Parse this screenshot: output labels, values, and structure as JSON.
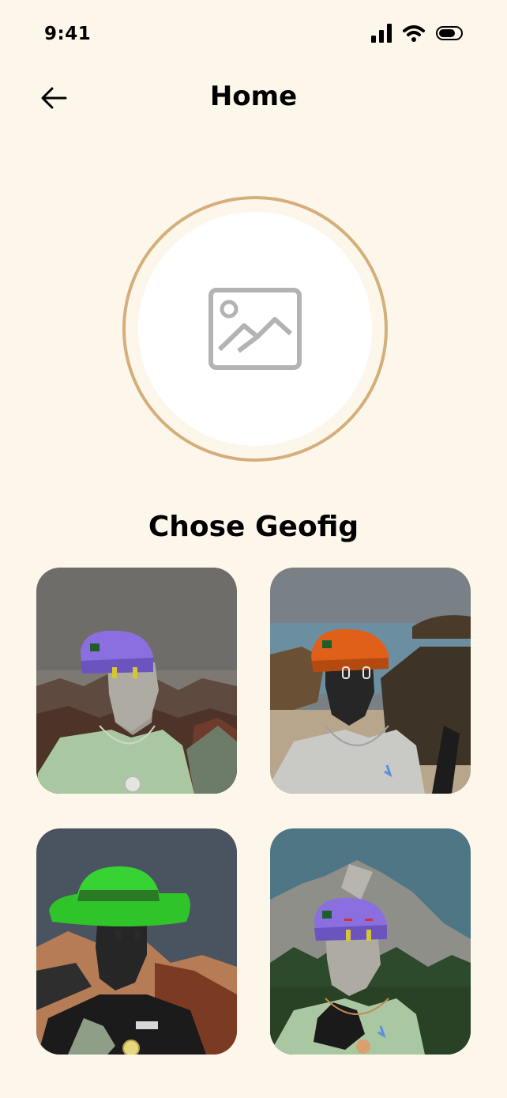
{
  "status_bar": {
    "time": "9:41"
  },
  "header": {
    "title": "Home"
  },
  "avatar": {
    "state": "empty",
    "placeholder_icon": "image-placeholder-icon"
  },
  "section": {
    "title": "Chose Geofig"
  },
  "geofigs": [
    {
      "hat_color": "#8b6fe0",
      "background": "foggy-city"
    },
    {
      "hat_color": "#e0601a",
      "background": "beach-rocks"
    },
    {
      "hat_color": "#2fc42a",
      "background": "desert-mountains"
    },
    {
      "hat_color": "#8b6fe0",
      "background": "forest-mountain"
    }
  ],
  "colors": {
    "background": "#fdf6ea",
    "accent_ring": "#d4ae7b"
  }
}
